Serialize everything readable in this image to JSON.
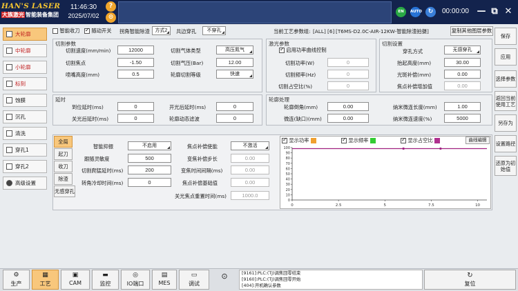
{
  "header": {
    "brand_line1": "HAN'S LASER",
    "brand_prefix": "大族激光",
    "brand_suffix": "智能装备集团",
    "time": "11:46:30",
    "date": "2025/07/02",
    "lang_badge": "EN",
    "auto_badge": "AUTO",
    "timer": "00:00:00",
    "minimize": "—",
    "restore": "⧉",
    "close": "✕"
  },
  "sidebar": {
    "items": [
      {
        "label": "大轮廓",
        "active": true,
        "red": true
      },
      {
        "label": "中轮廓",
        "red": true
      },
      {
        "label": "小轮廓",
        "red": true
      },
      {
        "label": "标刻",
        "red": true
      },
      {
        "label": "蚀膜"
      },
      {
        "label": "沉孔"
      },
      {
        "label": "清洗"
      },
      {
        "label": "穿孔1"
      },
      {
        "label": "穿孔2"
      },
      {
        "label": "高级设置"
      }
    ]
  },
  "toolbar": {
    "smart_lift": "智能收刀",
    "follow_switch": "随动开关",
    "corner_label": "拐角智能除渣",
    "corner_value": "方式2",
    "coedge_label": "共边穿孔",
    "coedge_value": "不穿孔",
    "process_label": "当前工艺参数组:",
    "process_group": "[ALL]",
    "process_no": "[6]",
    "process_name": "[T6MS-D2.0C-AIR-12KW-智能除渣拍摄]",
    "copy_button": "复制其他图层参数"
  },
  "cut_params": {
    "title": "切割参数",
    "speed_label": "切割速度(mm/min)",
    "speed_value": "12000",
    "focus_label": "切割焦点",
    "focus_value": "-1.50",
    "nozzle_label": "喷嘴高度(mm)",
    "nozzle_value": "0.5",
    "gas_type_label": "切割气体类型",
    "gas_type_value": "高压氮气",
    "gas_pressure_label": "切割气压(Bar)",
    "gas_pressure_value": "12.00",
    "contour_level_label": "轮廓切割等级",
    "contour_level_value": "快速"
  },
  "laser_params": {
    "title": "激光参数",
    "curve_enable": "启用功率曲线控制",
    "power_label": "切割功率(W)",
    "power_value": "0",
    "freq_label": "切割频率(Hz)",
    "freq_value": "0",
    "duty_label": "切割占空比(%)",
    "duty_value": "0"
  },
  "pierce_settings": {
    "title": "切割设置",
    "pierce_mode_label": "穿孔方式",
    "pierce_mode_value": "无感穿孔",
    "lift_height_label": "抬起高度(mm)",
    "lift_height_value": "30.00",
    "light_comp_label": "光斑补偿(mm)",
    "light_comp_value": "0.00",
    "focus_comp_label": "焦点补偿增加值",
    "focus_comp_value": "0.00"
  },
  "delay": {
    "title": "延时",
    "arrive_label": "到位延时(ms)",
    "arrive_value": "0",
    "off_label": "关光后延时(ms)",
    "off_value": "0",
    "on_label": "开光后延时(ms)",
    "on_value": "0",
    "dynamic_label": "轮廓动态滤波",
    "dynamic_value": "0"
  },
  "corner": {
    "title": "轮廓处理",
    "round_label": "轮廓倒角(mm)",
    "round_value": "0.00",
    "micro_label": "微连(缺口)(mm)",
    "micro_value": "0.00",
    "nano_len_label": "纳米微连长度(mm)",
    "nano_len_value": "1.00",
    "nano_speed_label": "纳米微连速度(%)",
    "nano_speed_value": "5000"
  },
  "subtabs": [
    "全局",
    "起刀",
    "收刀",
    "除渣",
    "无感穿孔"
  ],
  "global_params": {
    "smart_damp_label": "智能抑振",
    "smart_damp_value": "不启用",
    "follow_acc_label": "跟随灵敏度",
    "follow_acc_value": "500",
    "slope_delay_label": "切割爬猛延时(ms)",
    "slope_delay_value": "200",
    "corner_cool_label": "转角冷却时间(ms)",
    "corner_cool_value": "0",
    "focus_comp_enable_label": "焦点补偿使能",
    "focus_comp_enable_value": "不激活",
    "var_step_label": "变焦补偿步长",
    "var_step_value": "0.00",
    "var_time_label": "变焦时间间隔(ms)",
    "var_time_value": "0.00",
    "base_label": "焦点补偿基础值",
    "base_value": "0.00",
    "reset_time_label": "关光焦点重置时间(ms)",
    "reset_time_value": "1000.0"
  },
  "chart_legend": {
    "power": "显示功率",
    "freq": "显示频率",
    "duty": "显示占空比",
    "edit": "曲线编辑",
    "power_color": "#f0a030",
    "freq_color": "#33cc33",
    "duty_color": "#b0308f"
  },
  "chart_data": {
    "type": "line",
    "xlim": [
      0,
      10.5
    ],
    "ylim": [
      0,
      100
    ],
    "xticks": [
      "0",
      "2.5",
      "5",
      "7.5",
      "10"
    ],
    "yticks": [
      "0",
      "10",
      "20",
      "30",
      "40",
      "50",
      "60",
      "70",
      "80",
      "90",
      "100"
    ],
    "series": [
      {
        "color": "#a02080",
        "x": [
          0,
          6,
          8,
          10.5
        ],
        "y": [
          98,
          98,
          98,
          98
        ],
        "markers": [
          6,
          8
        ]
      }
    ]
  },
  "right_column": [
    "保存",
    "应用",
    "选择参数",
    "返回当前使用工艺",
    "另存为",
    "设置路径",
    "还原为初始值"
  ],
  "bottom": {
    "buttons": [
      "生产",
      "工艺",
      "CAM",
      "监控",
      "IO端口",
      "MES",
      "调试"
    ],
    "log": [
      "[9161]:PLC:(TJ)调焦回零结束",
      "[9160]:PLC:(TJ)调焦回零开始",
      "[404]:开机确认参数"
    ],
    "reset": "复位"
  }
}
